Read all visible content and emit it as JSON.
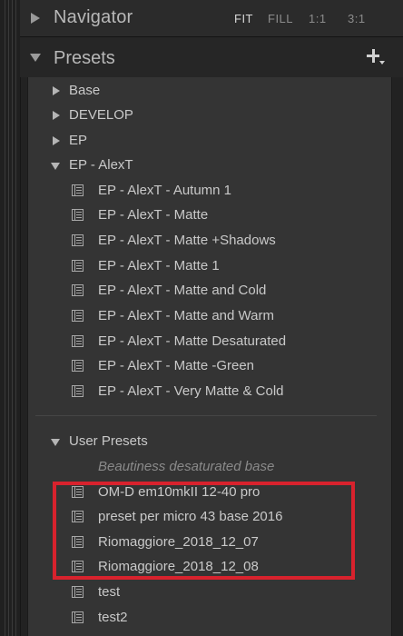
{
  "navigator": {
    "title": "Navigator",
    "options": [
      "FIT",
      "FILL",
      "1:1",
      "3:1"
    ],
    "active_option": "FIT"
  },
  "presets": {
    "title": "Presets",
    "add_icon": "plus-icon",
    "folders_top": [
      {
        "label": "Base",
        "expanded": false
      },
      {
        "label": "DEVELOP",
        "expanded": false
      },
      {
        "label": "EP",
        "expanded": false
      },
      {
        "label": "EP - AlexT",
        "expanded": true
      }
    ],
    "alext_presets": [
      "EP - AlexT - Autumn 1",
      "EP - AlexT - Matte",
      "EP - AlexT - Matte +Shadows",
      "EP - AlexT - Matte 1",
      "EP - AlexT - Matte and Cold",
      "EP - AlexT - Matte and Warm",
      "EP - AlexT - Matte Desaturated",
      "EP - AlexT - Matte -Green",
      "EP - AlexT - Very Matte & Cold"
    ],
    "user_folder": {
      "label": "User Presets",
      "expanded": true
    },
    "user_presets": [
      {
        "label": "Beautiness desaturated base",
        "dimmed": true
      },
      {
        "label": "OM-D em10mkII 12-40 pro",
        "dimmed": false
      },
      {
        "label": "preset per micro 43 base 2016",
        "dimmed": false
      },
      {
        "label": "Riomaggiore_2018_12_07",
        "dimmed": false
      },
      {
        "label": "Riomaggiore_2018_12_08",
        "dimmed": false
      },
      {
        "label": "test",
        "dimmed": false
      },
      {
        "label": "test2",
        "dimmed": false
      }
    ]
  },
  "colors": {
    "highlight_box": "#d8222d",
    "panel_bg": "#343434",
    "text": "#c9c9c9"
  }
}
